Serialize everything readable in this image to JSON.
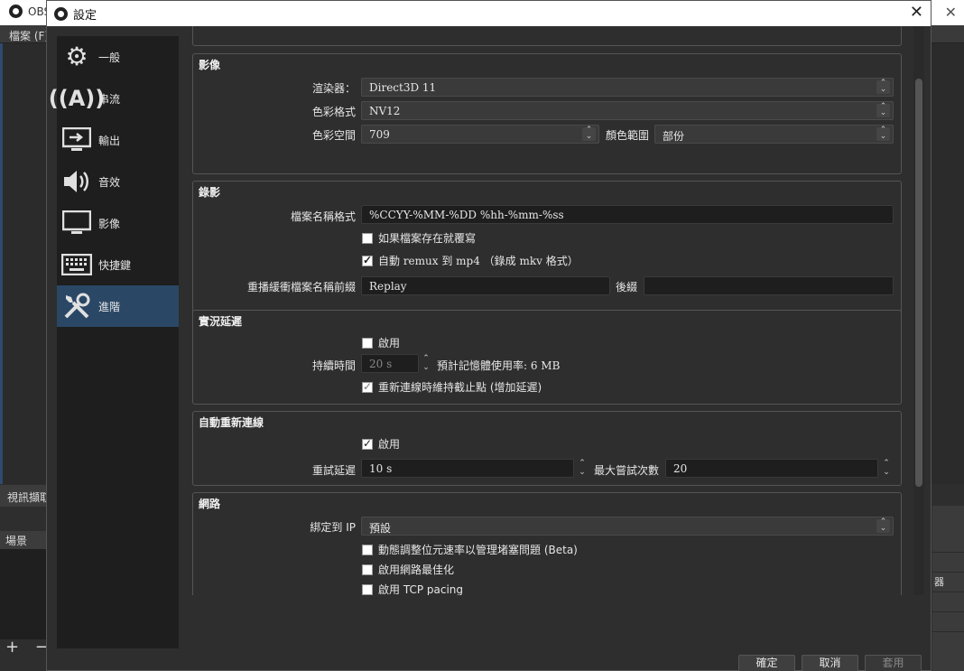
{
  "background": {
    "app_title": "OBS",
    "menu_file": "檔案 (F)",
    "dock_sources_header": "視訊擷取",
    "dock_scenes_header": "場景",
    "dock_tools": "+ −",
    "right_rows": [
      "",
      "",
      "",
      "器",
      "",
      ""
    ]
  },
  "dialog": {
    "title": "設定",
    "close": "✕"
  },
  "sidebar": {
    "items": [
      {
        "label": "一般",
        "icon": "gear-icon",
        "glyph": "⚙"
      },
      {
        "label": "串流",
        "icon": "antenna-icon",
        "glyph": "📡"
      },
      {
        "label": "輸出",
        "icon": "output-monitor-icon",
        "glyph": "⇥"
      },
      {
        "label": "音效",
        "icon": "speaker-icon",
        "glyph": "🔊"
      },
      {
        "label": "影像",
        "icon": "monitor-icon",
        "glyph": "🖥"
      },
      {
        "label": "快捷鍵",
        "icon": "keyboard-icon",
        "glyph": "⌨"
      },
      {
        "label": "進階",
        "icon": "tools-icon",
        "glyph": "🛠"
      }
    ],
    "active_index": 6
  },
  "video": {
    "title": "影像",
    "renderer_label": "渲染器：",
    "renderer_value": "Direct3D 11",
    "color_format_label": "色彩格式",
    "color_format_value": "NV12",
    "color_space_label": "色彩空間",
    "color_space_value": "709",
    "color_range_label": "顏色範圍",
    "color_range_value": "部份"
  },
  "recording": {
    "title": "錄影",
    "filename_label": "檔案名稱格式",
    "filename_value": "%CCYY-%MM-%DD %hh-%mm-%ss",
    "overwrite_label": "如果檔案存在就覆寫",
    "overwrite_checked": false,
    "remux_label": "自動 remux 到 mp4 （錄成 mkv 格式）",
    "remux_checked": true,
    "replay_prefix_label": "重播緩衝檔案名稱前綴",
    "replay_prefix_value": "Replay",
    "suffix_label": "後綴",
    "suffix_value": ""
  },
  "stream_delay": {
    "title": "實況延遲",
    "enable_label": "啟用",
    "enable_checked": false,
    "duration_label": "持續時間",
    "duration_value": "20 s",
    "memory_estimate": "預計記憶體使用率: 6 MB",
    "preserve_label": "重新連線時維持截止點 (增加延遲)",
    "preserve_checked": true
  },
  "reconnect": {
    "title": "自動重新連線",
    "enable_label": "啟用",
    "enable_checked": true,
    "retry_delay_label": "重試延遲",
    "retry_delay_value": "10 s",
    "max_retries_label": "最大嘗試次數",
    "max_retries_value": "20"
  },
  "network": {
    "title": "網路",
    "bind_ip_label": "綁定到 IP",
    "bind_ip_value": "預設",
    "dynamic_bitrate_label": "動態調整位元速率以管理堵塞問題 (Beta)",
    "dynamic_bitrate_checked": false,
    "net_opt_label": "啟用網路最佳化",
    "net_opt_checked": false,
    "tcp_pacing_label": "啟用 TCP pacing",
    "tcp_pacing_checked": false
  },
  "buttons": {
    "ok": "確定",
    "cancel": "取消",
    "apply": "套用"
  }
}
